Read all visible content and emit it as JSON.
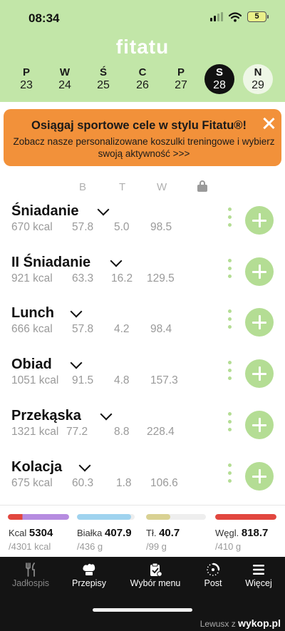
{
  "status": {
    "time": "08:34",
    "battery": "5"
  },
  "app": {
    "logo": "fitatu"
  },
  "week": [
    {
      "letter": "P",
      "date": "23"
    },
    {
      "letter": "W",
      "date": "24"
    },
    {
      "letter": "Ś",
      "date": "25"
    },
    {
      "letter": "C",
      "date": "26"
    },
    {
      "letter": "P",
      "date": "27"
    },
    {
      "letter": "S",
      "date": "28",
      "selected": true
    },
    {
      "letter": "N",
      "date": "29"
    }
  ],
  "banner": {
    "title": "Osiągaj sportowe cele w stylu Fitatu®!",
    "text": "Zobacz nasze personalizowane koszulki treningowe i wybierz swoją aktywność >>>"
  },
  "columns": {
    "b": "B",
    "t": "T",
    "w": "W"
  },
  "meals": [
    {
      "name": "Śniadanie",
      "kcal": "670 kcal",
      "b": "57.8",
      "t": "5.0",
      "w": "98.5"
    },
    {
      "name": "II Śniadanie",
      "kcal": "921 kcal",
      "b": "63.3",
      "t": "16.2",
      "w": "129.5"
    },
    {
      "name": "Lunch",
      "kcal": "666 kcal",
      "b": "57.8",
      "t": "4.2",
      "w": "98.4"
    },
    {
      "name": "Obiad",
      "kcal": "1051 kcal",
      "b": "91.5",
      "t": "4.8",
      "w": "157.3"
    },
    {
      "name": "Przekąska",
      "kcal": "1321 kcal",
      "b": "77.2",
      "t": "8.8",
      "w": "228.4"
    },
    {
      "name": "Kolacja",
      "kcal": "675 kcal",
      "b": "60.3",
      "t": "1.8",
      "w": "106.6"
    }
  ],
  "totals": {
    "kcal": {
      "label": "Kcal",
      "value": "5304",
      "goal": "/4301 kcal",
      "progress": 1.0
    },
    "protein": {
      "label": "Białka",
      "value": "407.9",
      "goal": "/436 g",
      "progress": 0.94
    },
    "fat": {
      "label": "Tł.",
      "value": "40.7",
      "goal": "/99 g",
      "progress": 0.41
    },
    "carbs": {
      "label": "Węgl.",
      "value": "818.7",
      "goal": "/410 g",
      "progress": 1.0
    }
  },
  "colors": {
    "header_bg": "#c2e6a8",
    "accent_green": "#b4dd94",
    "banner_bg": "#f2913a",
    "kcal_bar_start": "#e2473f",
    "kcal_bar_end": "#b68ce0",
    "protein_bar": "#9fd3ef",
    "fat_bar": "#d9d193",
    "carbs_bar": "#e2473f"
  },
  "nav": [
    {
      "label": "Jadłospis",
      "icon": "fork-knife-icon",
      "active": true
    },
    {
      "label": "Przepisy",
      "icon": "chef-hat-icon"
    },
    {
      "label": "Wybór menu",
      "icon": "clipboard-icon"
    },
    {
      "label": "Post",
      "icon": "fasting-clock-icon"
    },
    {
      "label": "Więcej",
      "icon": "menu-icon"
    }
  ],
  "watermark": {
    "user": "Lewusx",
    "z": "z",
    "site": "wykop.pl"
  }
}
